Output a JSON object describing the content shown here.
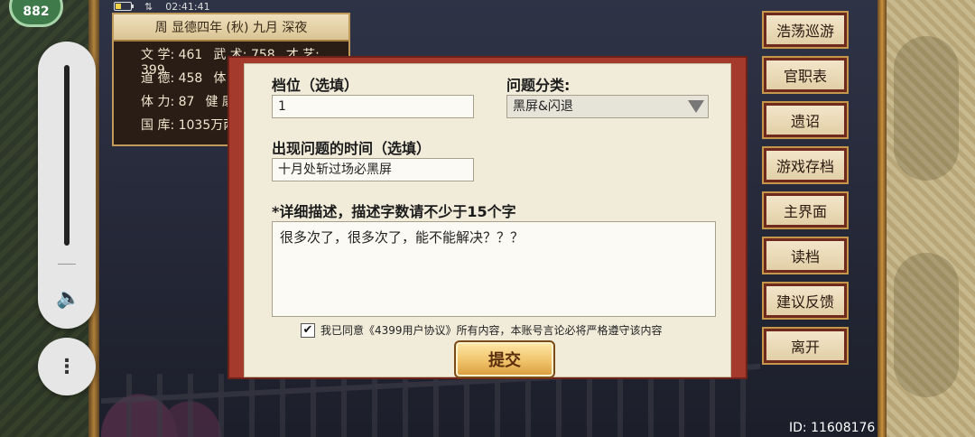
{
  "status": {
    "fps": "882",
    "time": "02:41:41"
  },
  "stats_panel": {
    "date": "周 显德四年 (秋) 九月 深夜",
    "rows": [
      [
        "文 学: 461",
        "武 术: 758",
        "才 艺: 399"
      ],
      [
        "道 德: 458",
        "体 能"
      ],
      [
        "体 力: 87",
        "健 康"
      ],
      [
        "国 库: 1035万两"
      ]
    ]
  },
  "menu": [
    "浩荡巡游",
    "官职表",
    "遗诏",
    "游戏存档",
    "主界面",
    "读档",
    "建议反馈",
    "离开"
  ],
  "footer": {
    "user_id": "ID: 11608176"
  },
  "dialog": {
    "slot_label": "档位（选填）",
    "slot_value": "1",
    "category_label": "问题分类:",
    "category_value": "黑屏&闪退",
    "time_label": "出现问题的时间（选填）",
    "time_value": "十月处斩过场必黑屏",
    "desc_label": "*详细描述，描述字数请不少于15个字",
    "desc_value": "很多次了，很多次了，能不能解决？？？",
    "agree_checked": true,
    "agree_text": "我已同意《4399用户协议》所有内容，本账号言论必将严格遵守该内容",
    "submit_label": "提交"
  }
}
